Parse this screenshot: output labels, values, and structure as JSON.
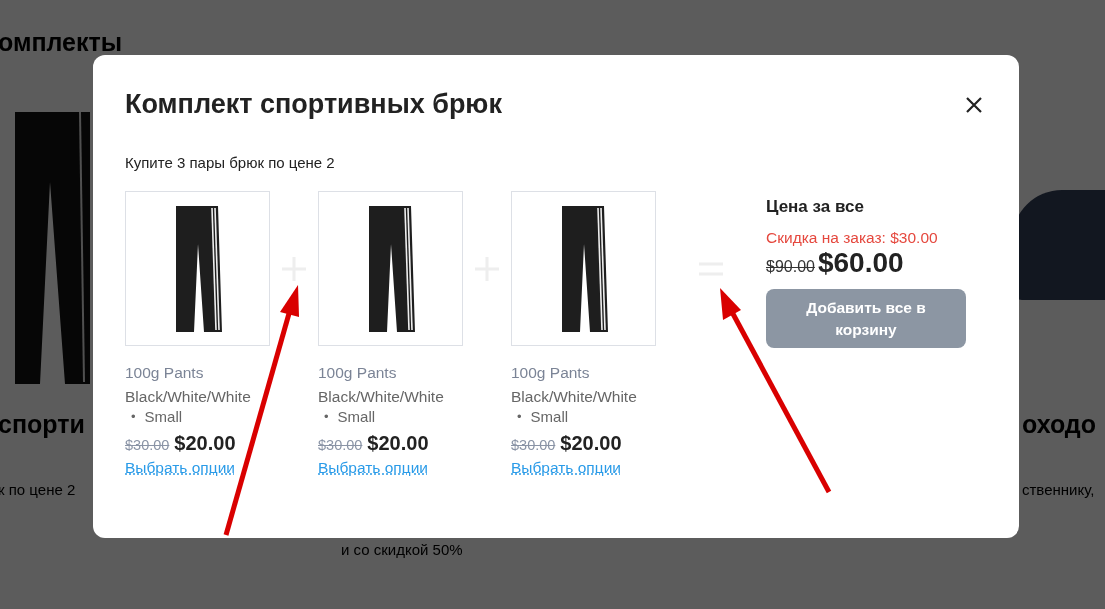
{
  "background": {
    "heading": "омплекты",
    "products": [
      {
        "title": "спорти",
        "description": "к по цене 2"
      },
      {
        "description": "и со скидкой 50%"
      },
      {
        "title": "оходо",
        "description": "ственнику,"
      }
    ]
  },
  "modal": {
    "title": "Комплект спортивных брюк",
    "subtitle": "Купите 3 пары брюк по цене 2",
    "items": [
      {
        "name": "100g Pants",
        "variant": "Black/White/White",
        "bullet": "•",
        "option": "Small",
        "old_price": "$30.00",
        "price": "$20.00",
        "link": "Выбрать опции"
      },
      {
        "name": "100g Pants",
        "variant": "Black/White/White",
        "bullet": "•",
        "option": "Small",
        "old_price": "$30.00",
        "price": "$20.00",
        "link": "Выбрать опции"
      },
      {
        "name": "100g Pants",
        "variant": "Black/White/White",
        "bullet": "•",
        "option": "Small",
        "old_price": "$30.00",
        "price": "$20.00",
        "link": "Выбрать опции"
      }
    ],
    "summary": {
      "heading": "Цена за все",
      "discount": "Скидка на заказ: $30.00",
      "old_price": "$90.00",
      "price": "$60.00",
      "button": "Добавить все в корзину"
    }
  }
}
